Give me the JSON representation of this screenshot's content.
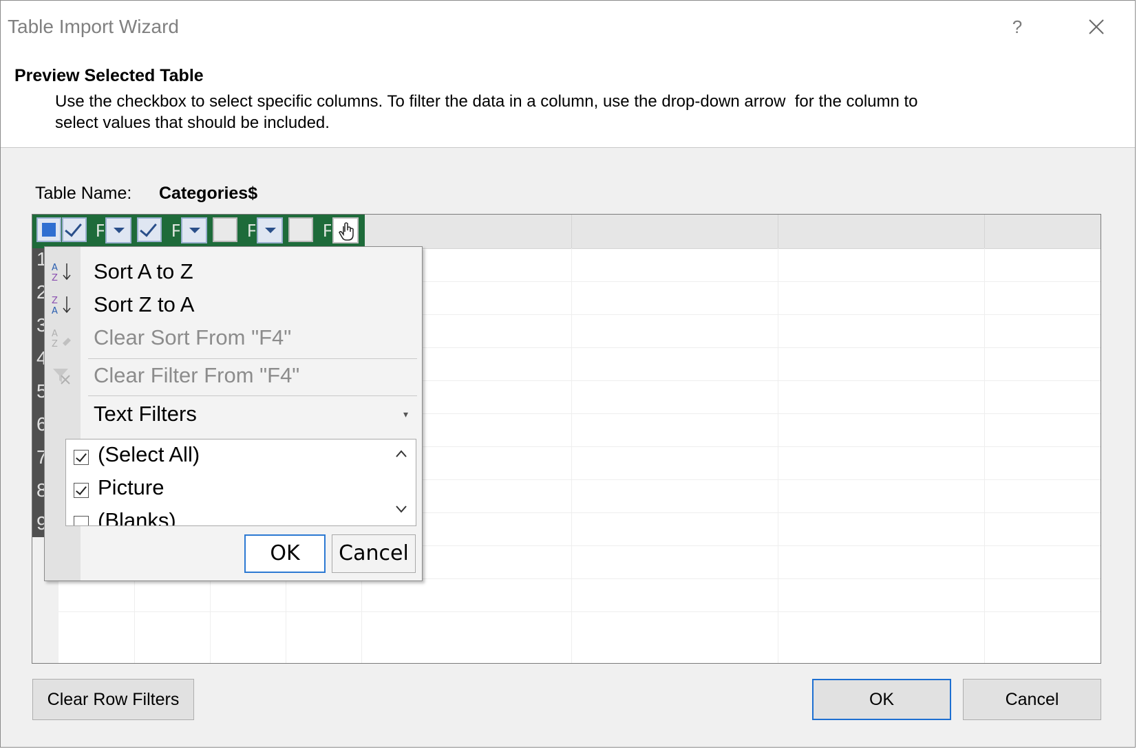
{
  "window": {
    "title": "Table Import Wizard",
    "help_label": "?"
  },
  "header": {
    "title": "Preview Selected Table",
    "description": "Use the checkbox to select specific columns. To filter the data in a column, use the drop-down arrow  for the column to\nselect values that should be included."
  },
  "table": {
    "name_label": "Table Name:",
    "name_value": "Categories$",
    "header_letter": "F",
    "row_numbers": [
      "1",
      "2",
      "3",
      "4",
      "5",
      "6",
      "7",
      "8",
      "9"
    ]
  },
  "filter_menu": {
    "sort_az": "Sort A to Z",
    "sort_za": "Sort Z to A",
    "clear_sort": "Clear Sort From \"F4\"",
    "clear_filter": "Clear Filter From \"F4\"",
    "text_filters": "Text Filters",
    "list_items": [
      {
        "label": "(Select All)",
        "checked": true
      },
      {
        "label": "Picture",
        "checked": true
      },
      {
        "label": "(Blanks)",
        "checked": false
      }
    ],
    "ok_label": "OK",
    "cancel_label": "Cancel"
  },
  "footer": {
    "clear_row_filters": "Clear Row Filters",
    "ok_label": "OK",
    "cancel_label": "Cancel"
  },
  "colors": {
    "header_green": "#1e6b3a",
    "accent_blue": "#1d6fd1"
  }
}
